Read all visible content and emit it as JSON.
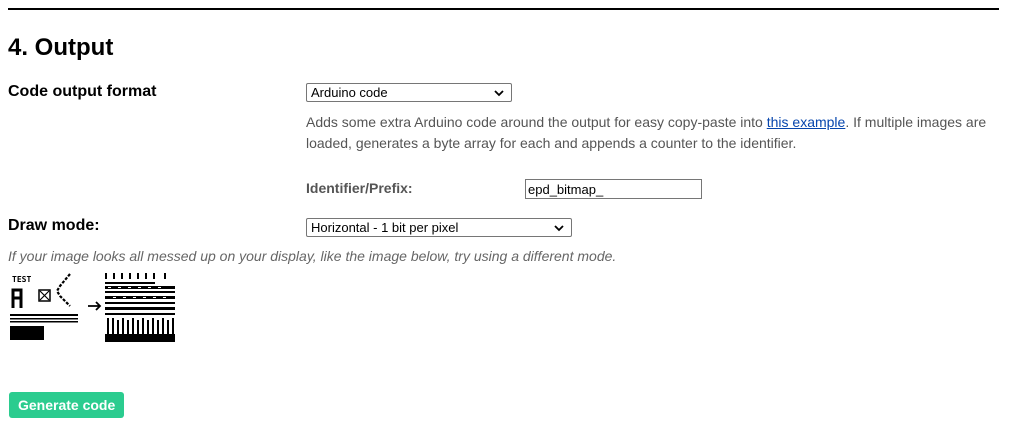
{
  "section": {
    "title": "4. Output"
  },
  "code_output": {
    "label": "Code output format",
    "selected": "Arduino code",
    "description_before": "Adds some extra Arduino code around the output for easy copy-paste into ",
    "link_text": "this example",
    "description_after": ". If multiple images are loaded, generates a byte array for each and appends a counter to the identifier."
  },
  "identifier": {
    "label": "Identifier/Prefix:",
    "value": "epd_bitmap_"
  },
  "draw_mode": {
    "label": "Draw mode:",
    "selected": "Horizontal - 1 bit per pixel",
    "note": "If your image looks all messed up on your display, like the image below, try using a different mode."
  },
  "example_image": {
    "label": "TEST"
  },
  "generate": {
    "label": "Generate code"
  },
  "colors": {
    "button": "#2bcc8f",
    "link": "#0645ad",
    "muted": "#555555"
  }
}
